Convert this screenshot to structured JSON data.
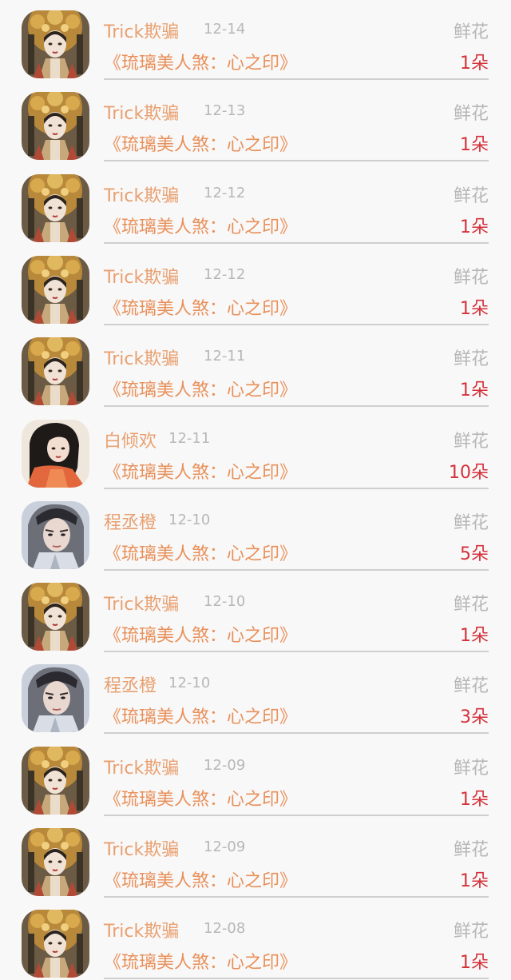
{
  "list_items": [
    {
      "user": "Trick欺骗",
      "date": "12-14",
      "book": "《琉璃美人煞：心之印》",
      "gift": "鲜花",
      "count": "1朵",
      "avatar": "ornate-headdress-portrait"
    },
    {
      "user": "Trick欺骗",
      "date": "12-13",
      "book": "《琉璃美人煞：心之印》",
      "gift": "鲜花",
      "count": "1朵",
      "avatar": "ornate-headdress-portrait"
    },
    {
      "user": "Trick欺骗",
      "date": "12-12",
      "book": "《琉璃美人煞：心之印》",
      "gift": "鲜花",
      "count": "1朵",
      "avatar": "ornate-headdress-portrait"
    },
    {
      "user": "Trick欺骗",
      "date": "12-12",
      "book": "《琉璃美人煞：心之印》",
      "gift": "鲜花",
      "count": "1朵",
      "avatar": "ornate-headdress-portrait"
    },
    {
      "user": "Trick欺骗",
      "date": "12-11",
      "book": "《琉璃美人煞：心之印》",
      "gift": "鲜花",
      "count": "1朵",
      "avatar": "ornate-headdress-portrait"
    },
    {
      "user": "白倾欢",
      "date": "12-11",
      "book": "《琉璃美人煞：心之印》",
      "gift": "鲜花",
      "count": "10朵",
      "avatar": "dark-hair-red-robe-portrait"
    },
    {
      "user": "程丞橙",
      "date": "12-10",
      "book": "《琉璃美人煞：心之印》",
      "gift": "鲜花",
      "count": "5朵",
      "avatar": "pale-man-portrait"
    },
    {
      "user": "Trick欺骗",
      "date": "12-10",
      "book": "《琉璃美人煞：心之印》",
      "gift": "鲜花",
      "count": "1朵",
      "avatar": "ornate-headdress-portrait"
    },
    {
      "user": "程丞橙",
      "date": "12-10",
      "book": "《琉璃美人煞：心之印》",
      "gift": "鲜花",
      "count": "3朵",
      "avatar": "pale-man-portrait"
    },
    {
      "user": "Trick欺骗",
      "date": "12-09",
      "book": "《琉璃美人煞：心之印》",
      "gift": "鲜花",
      "count": "1朵",
      "avatar": "ornate-headdress-portrait"
    },
    {
      "user": "Trick欺骗",
      "date": "12-09",
      "book": "《琉璃美人煞：心之印》",
      "gift": "鲜花",
      "count": "1朵",
      "avatar": "ornate-headdress-portrait"
    },
    {
      "user": "Trick欺骗",
      "date": "12-08",
      "book": "《琉璃美人煞：心之印》",
      "gift": "鲜花",
      "count": "1朵",
      "avatar": "ornate-headdress-portrait"
    }
  ],
  "colors": {
    "user_name": "#e8a070",
    "book_title": "#e8905a",
    "count": "#d4313a",
    "muted": "#b7b7b7",
    "background": "#f9f8f8"
  }
}
